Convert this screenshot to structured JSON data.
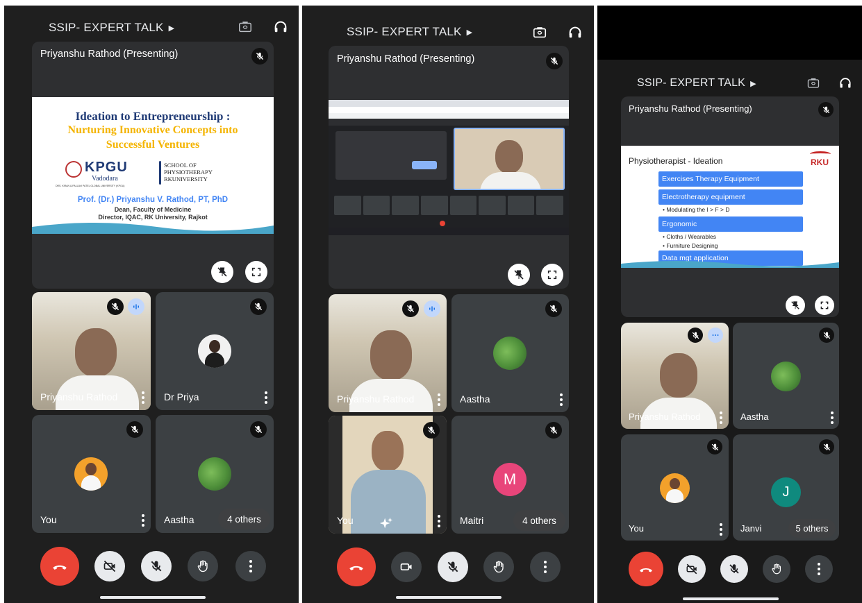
{
  "header": {
    "meeting_title": "SSIP- EXPERT TALK"
  },
  "presenter_label": "Priyanshu Rathod (Presenting)",
  "slide1": {
    "title_line1": "Ideation to Entrepreneurship :",
    "title_line2": "Nurturing Innovative Concepts into",
    "title_line3": "Successful Ventures",
    "logo_kpgu": "KPGU",
    "logo_kpgu_sub": "Vadodara",
    "logo_kpgu_tagline": "DRS. KIRAN & PALLAVI PATEL GLOBAL UNIVERSITY (KPGU)",
    "logo_school_line1": "SCHOOL OF",
    "logo_school_line2": "PHYSIOTHERAPY",
    "logo_school_line3": "RKUNIVERSITY",
    "speaker": "Prof. (Dr.) Priyanshu V. Rathod, PT, PhD",
    "role1": "Dean, Faculty of Medicine",
    "role2": "Director, IQAC, RK University, Rajkot"
  },
  "slide3": {
    "title": "Physiotherapist - Ideation",
    "logo": "RKU",
    "items": [
      "Exercises Therapy Equipment",
      "Electrotherapy equipment",
      "Ergonomic",
      "Data mgt application"
    ],
    "bullet_electro": "• Modulating the I > F > D",
    "bullet_ergo1": "• Cloths / Wearables",
    "bullet_ergo2": "• Furniture Designing"
  },
  "panel1": {
    "tiles": {
      "t1": "Priyanshu Rathod",
      "t2": "Dr Priya",
      "t3": "You",
      "t4": "Aastha",
      "others": "4 others"
    }
  },
  "panel2": {
    "tiles": {
      "t1": "Priyanshu Rathod",
      "t2": "Aastha",
      "t3": "You",
      "t4": "Maitri",
      "t4_letter": "M",
      "others": "4 others"
    }
  },
  "panel3": {
    "tiles": {
      "t1": "Priyanshu Rathod",
      "t2": "Aastha",
      "t3": "You",
      "t4": "Janvi",
      "t4_letter": "J",
      "others": "5 others"
    }
  },
  "colors": {
    "end_call": "#ea4335",
    "maitri_avatar": "#e8457a",
    "janvi_avatar": "#0f8a7e",
    "slide_blue": "#4285f4"
  },
  "icons": [
    "switch-camera-icon",
    "headphones-icon",
    "mic-off-icon",
    "fullscreen-icon",
    "pin-off-icon",
    "end-call-icon",
    "camera-off-icon",
    "camera-icon",
    "raise-hand-icon",
    "more-vert-icon",
    "sparkle-effects-icon",
    "audio-wave-icon"
  ]
}
